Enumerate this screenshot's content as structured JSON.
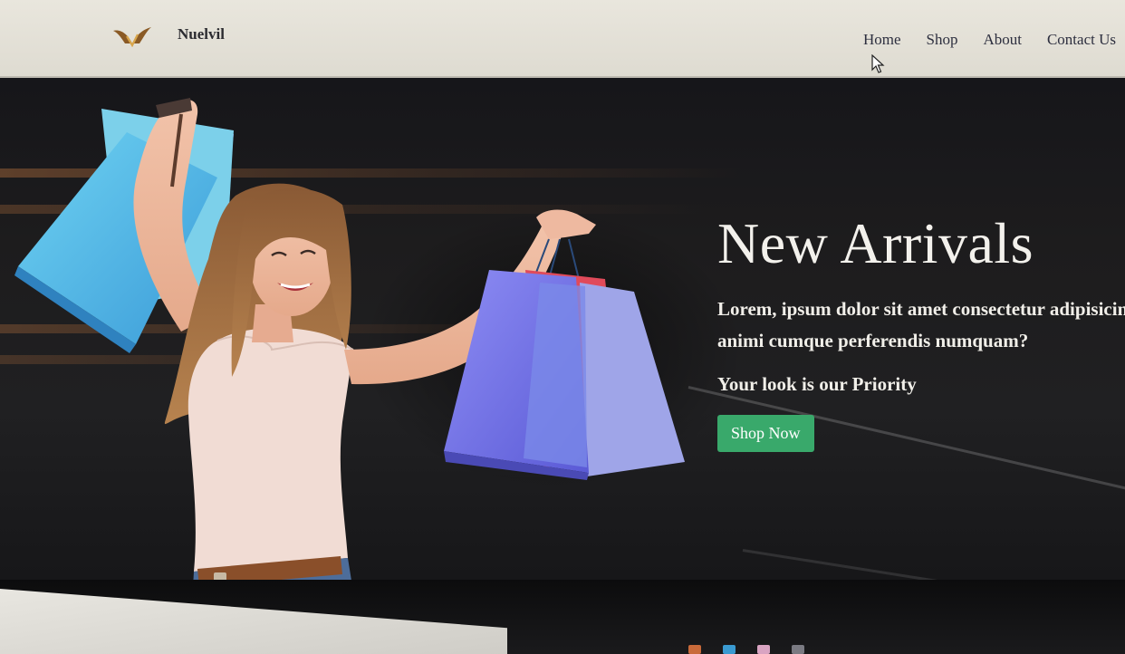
{
  "brand": {
    "name": "Nuelvil",
    "logo_icon": "wings-logo-icon"
  },
  "nav": {
    "items": [
      {
        "label": "Home"
      },
      {
        "label": "Shop"
      },
      {
        "label": "About"
      },
      {
        "label": "Contact Us"
      }
    ]
  },
  "hero": {
    "title": "New Arrivals",
    "description_line1": "Lorem, ipsum dolor sit amet consectetur adipisicin",
    "description_line2": "animi cumque perferendis numquam?",
    "tagline": "Your look is our Priority",
    "cta_label": "Shop Now",
    "image": "woman-holding-shopping-bags"
  },
  "colors": {
    "cta": "#39a96b",
    "nav_bg": "#e6e3da",
    "hero_bg": "#1d1c1d",
    "text_light": "#f1efe9"
  }
}
